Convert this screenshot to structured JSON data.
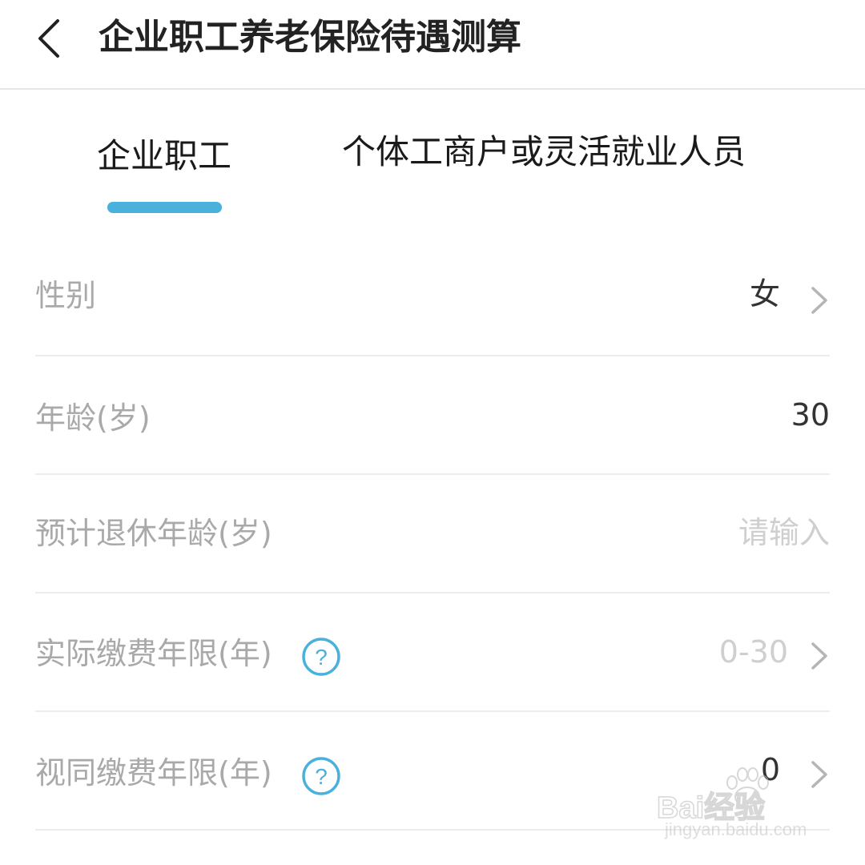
{
  "header": {
    "title": "企业职工养老保险待遇测算",
    "back_icon": "chevron-left-icon"
  },
  "tabs": [
    {
      "label": "企业职工",
      "active": true
    },
    {
      "label": "个体工商户或灵活就业人员",
      "active": false
    }
  ],
  "colors": {
    "accent": "#4ab0dc",
    "label": "#a9a9a9",
    "value": "#333333",
    "placeholder": "#cfcfcf"
  },
  "form": {
    "gender": {
      "label": "性别",
      "value": "女",
      "icon": "chevron-right-icon"
    },
    "age": {
      "label": "年龄(岁)",
      "value": "30"
    },
    "retire_age": {
      "label": "预计退休年龄(岁)",
      "placeholder": "请输入"
    },
    "actual_years": {
      "label": "实际缴费年限(年)",
      "placeholder": "0-30",
      "help_icon": "question-circle-icon",
      "icon": "chevron-right-icon"
    },
    "deemed_years": {
      "label": "视同缴费年限(年)",
      "value": "0",
      "help_icon": "question-circle-icon",
      "icon": "chevron-right-icon"
    }
  },
  "watermark": {
    "brand": "Bai经验",
    "url": "jingyan.baidu.com"
  }
}
